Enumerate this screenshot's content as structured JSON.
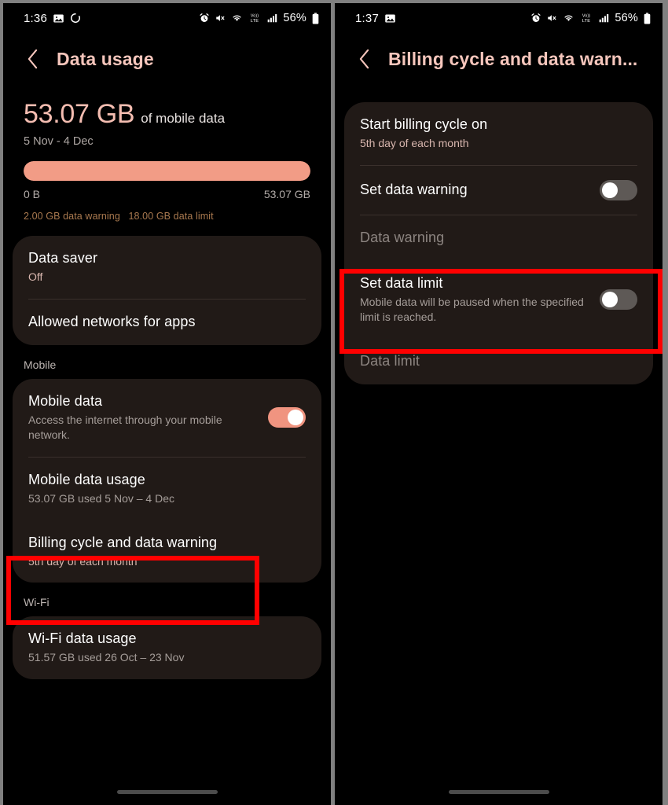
{
  "left_phone": {
    "status_bar": {
      "time": "1:36",
      "left_icons": [
        "photo-icon",
        "loading-circle-icon"
      ],
      "right_icons": [
        "alarm-icon",
        "mute-icon",
        "wifi-icon",
        "volte-icon",
        "signal-bars-icon"
      ],
      "battery_percent": "56%"
    },
    "appbar": {
      "back_label": "back-arrow",
      "title": "Data usage"
    },
    "usage": {
      "amount": "53.07 GB",
      "amount_suffix": "of mobile data",
      "date_range": "5 Nov - 4 Dec",
      "bar_fill_percent": 100,
      "scale_min": "0 B",
      "scale_max": "53.07 GB",
      "warning_note": "2.00 GB data warning",
      "limit_note": "18.00 GB data limit"
    },
    "card_general": [
      {
        "title": "Data saver",
        "sub": "Off",
        "sub_style": "pinkish"
      },
      {
        "title": "Allowed networks for apps",
        "sub": ""
      }
    ],
    "section_mobile_label": "Mobile",
    "card_mobile": [
      {
        "title": "Mobile data",
        "sub": "Access the internet through your mobile network.",
        "toggle": "on"
      },
      {
        "title": "Mobile data usage",
        "sub": "53.07 GB used 5 Nov – 4 Dec"
      },
      {
        "title": "Billing cycle and data warning",
        "sub": "5th day of each month",
        "sub_style": "pinkish",
        "highlighted": true
      }
    ],
    "section_wifi_label": "Wi-Fi",
    "card_wifi": [
      {
        "title": "Wi-Fi data usage",
        "sub": "51.57 GB used 26 Oct – 23 Nov"
      }
    ]
  },
  "right_phone": {
    "status_bar": {
      "time": "1:37",
      "left_icons": [
        "photo-icon"
      ],
      "right_icons": [
        "alarm-icon",
        "mute-icon",
        "wifi-icon",
        "volte-icon",
        "signal-bars-icon"
      ],
      "battery_percent": "56%"
    },
    "appbar": {
      "back_label": "back-arrow",
      "title": "Billing cycle and data warn..."
    },
    "card_billing": [
      {
        "title": "Start billing cycle on",
        "sub": "5th day of each month",
        "sub_style": "pinkish"
      },
      {
        "title": "Set data warning",
        "sub": "",
        "toggle": "off"
      },
      {
        "title": "Data warning",
        "sub": "",
        "disabled": true
      },
      {
        "title": "Set data limit",
        "sub": "Mobile data will be paused when the specified limit is reached.",
        "toggle": "off",
        "highlighted": true
      },
      {
        "title": "Data limit",
        "sub": "",
        "disabled": true
      }
    ]
  },
  "annotation": {
    "color": "#FF0000",
    "boxes": [
      {
        "target": "billing-cycle-and-data-warning-row"
      },
      {
        "target": "set-data-limit-row"
      }
    ]
  }
}
